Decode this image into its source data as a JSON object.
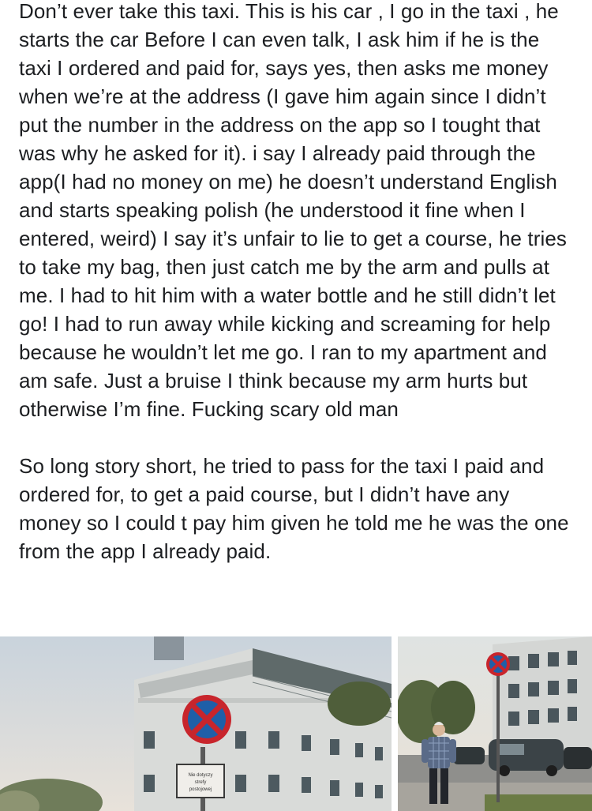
{
  "post": {
    "paragraphs": [
      "Don’t ever take this taxi. This is his car , I go in the taxi , he starts the car Before I can even talk, I ask him if he is the taxi I ordered and paid for, says yes, then asks me money when we’re at the address (I gave him again since I didn’t put the number in the address on the app so I tought that was why he asked for it). i say I already paid through the app(I had no money on me) he doesn’t understand English and starts speaking polish (he understood it fine when I entered, weird) I say it’s unfair to lie to get a course, he tries to take my bag, then just catch me by the arm and pulls at me. I had to hit him with a water bottle and he still didn’t let go! I had to run away while kicking and screaming for help because he wouldn’t let me go. I ran to my apartment and am safe. Just a bruise I think because my arm hurts but otherwise I’m fine. Fucking scary old man",
      "So long story short, he tried to pass for the taxi I paid and ordered for, to get a paid course, but I didn’t have any money so I could t pay him given he told me he was the one from the app I already paid."
    ]
  },
  "photos": {
    "left": {
      "sign_plate_text": "Nie dotyczy\nstrefy\npostojowej"
    },
    "right": {}
  },
  "colors": {
    "text": "#1c1e21",
    "background": "#ffffff",
    "sign_red": "#c8252c",
    "sign_blue": "#1f5fa8"
  }
}
